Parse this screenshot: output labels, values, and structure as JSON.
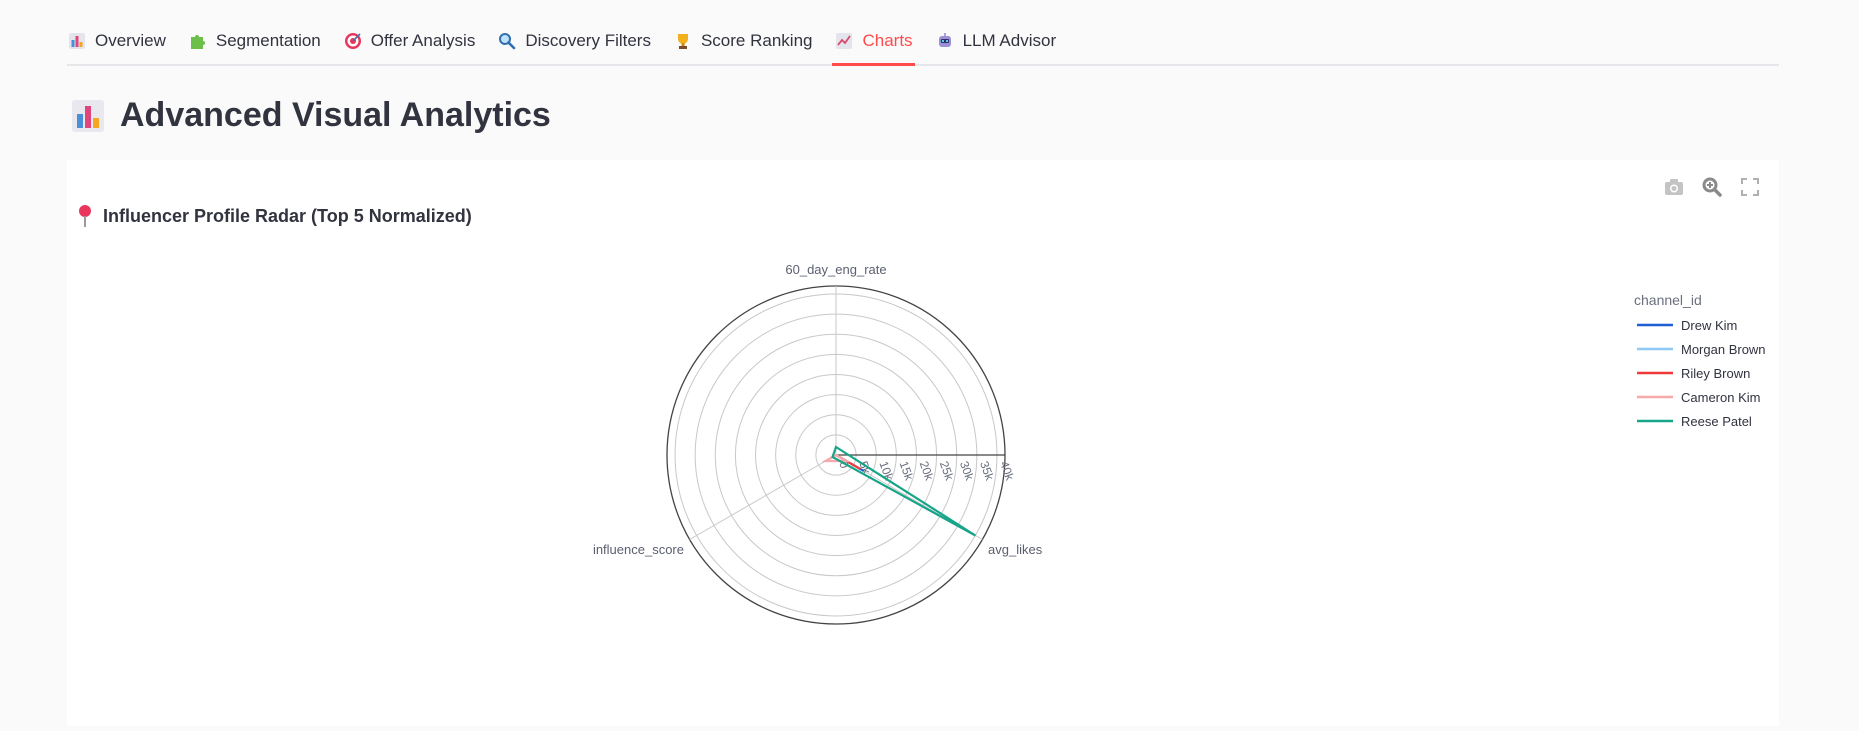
{
  "tabs": [
    {
      "label": "Overview",
      "icon": "bar-chart-icon",
      "active": false
    },
    {
      "label": "Segmentation",
      "icon": "puzzle-icon",
      "active": false
    },
    {
      "label": "Offer Analysis",
      "icon": "target-icon",
      "active": false
    },
    {
      "label": "Discovery Filters",
      "icon": "magnifier-icon",
      "active": false
    },
    {
      "label": "Score Ranking",
      "icon": "trophy-icon",
      "active": false
    },
    {
      "label": "Charts",
      "icon": "line-chart-icon",
      "active": true
    },
    {
      "label": "LLM Advisor",
      "icon": "robot-icon",
      "active": false
    }
  ],
  "page": {
    "title": "Advanced Visual Analytics",
    "title_icon": "bar-chart-icon"
  },
  "chart_card": {
    "title": "Influencer Profile Radar (Top 5 Normalized)",
    "title_icon": "pushpin-icon",
    "modebar": [
      "camera-icon",
      "zoom-icon",
      "fullscreen-icon"
    ]
  },
  "colors": {
    "accent": "#ff4b4b",
    "text": "#31333f",
    "grid": "#c8c8c8",
    "outer_ring": "#444444"
  },
  "chart_data": {
    "type": "radar",
    "axes": [
      "60_day_eng_rate",
      "avg_likes",
      "influence_score"
    ],
    "radial_ticks": [
      "0",
      "5k",
      "10k",
      "15k",
      "20k",
      "25k",
      "30k",
      "35k",
      "40k"
    ],
    "radial_range": [
      0,
      42000
    ],
    "legend_title": "channel_id",
    "legend_position": "right",
    "series": [
      {
        "name": "Drew Kim",
        "color": "#1f5fd6",
        "values": [
          0,
          8000,
          0
        ]
      },
      {
        "name": "Morgan Brown",
        "color": "#8ec9f7",
        "values": [
          0,
          6500,
          0
        ]
      },
      {
        "name": "Riley Brown",
        "color": "#f03a3a",
        "values": [
          0,
          7000,
          0
        ]
      },
      {
        "name": "Cameron Kim",
        "color": "#f7a8a8",
        "values": [
          0,
          3000,
          3000
        ]
      },
      {
        "name": "Reese Patel",
        "color": "#17a589",
        "values": [
          2000,
          40000,
          1000
        ]
      }
    ]
  }
}
